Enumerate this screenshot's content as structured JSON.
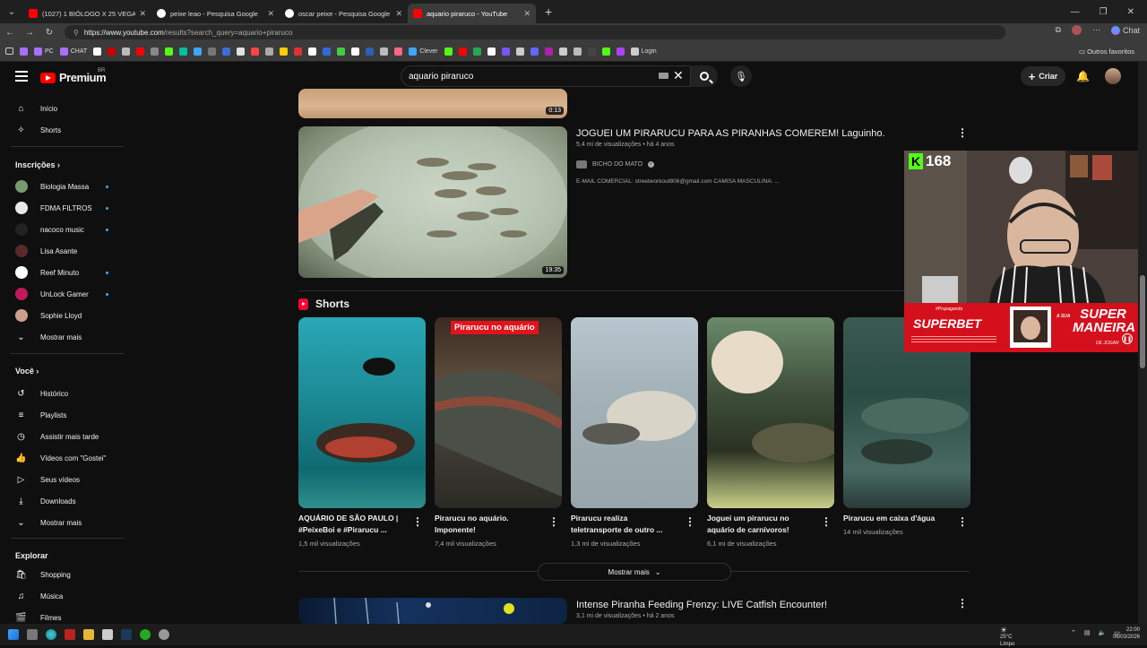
{
  "browser": {
    "tabs": [
      {
        "title": "(1027) 1 BIÓLOGO X 25 VEGANOS",
        "fav_color": "#ff0000",
        "active": false
      },
      {
        "title": "peixe leao - Pesquisa Google",
        "fav_color": "#ffffff",
        "active": false
      },
      {
        "title": "oscar peixe - Pesquisa Google",
        "fav_color": "#ffffff",
        "active": false
      },
      {
        "title": "aquario piraruco - YouTube",
        "fav_color": "#ff0000",
        "active": true
      }
    ],
    "url_host": "https://www.youtube.com",
    "url_path": "/results?search_query=aquario+piraruco",
    "chat_label": "Chat",
    "bookmarks": [
      {
        "label": "",
        "color": "#a970ff"
      },
      {
        "label": "PC",
        "color": "#a970ff"
      },
      {
        "label": "CHAT",
        "color": "#a970ff"
      },
      {
        "label": "",
        "color": "#ffffff"
      },
      {
        "label": "",
        "color": "#cc0000"
      },
      {
        "label": "",
        "color": "#bbbbbb"
      },
      {
        "label": "",
        "color": "#ff0000"
      },
      {
        "label": "",
        "color": "#888888"
      },
      {
        "label": "",
        "color": "#53fc18"
      },
      {
        "label": "",
        "color": "#00c0a0"
      },
      {
        "label": "",
        "color": "#3ea6ff"
      },
      {
        "label": "",
        "color": "#777777"
      },
      {
        "label": "",
        "color": "#3a6fd8"
      },
      {
        "label": "",
        "color": "#e0e0e0"
      },
      {
        "label": "",
        "color": "#ff4444"
      },
      {
        "label": "",
        "color": "#aaaaaa"
      },
      {
        "label": "",
        "color": "#ffcc00"
      },
      {
        "label": "",
        "color": "#d33"
      },
      {
        "label": "",
        "color": "#ffffff"
      },
      {
        "label": "",
        "color": "#2f6bd8"
      },
      {
        "label": "",
        "color": "#44cc44"
      },
      {
        "label": "",
        "color": "#ffffff"
      },
      {
        "label": "",
        "color": "#2b5fb8"
      },
      {
        "label": "",
        "color": "#bbbbbb"
      },
      {
        "label": "",
        "color": "#ff6688"
      },
      {
        "label": "Clever",
        "color": "#3ea6ff"
      },
      {
        "label": "",
        "color": "#53fc18"
      },
      {
        "label": "",
        "color": "#ff0000"
      },
      {
        "label": "",
        "color": "#22aa55"
      },
      {
        "label": "",
        "color": "#ffffff"
      },
      {
        "label": "",
        "color": "#7755ff"
      },
      {
        "label": "",
        "color": "#cccccc"
      },
      {
        "label": "",
        "color": "#6666ff"
      },
      {
        "label": "",
        "color": "#aa22aa"
      },
      {
        "label": "",
        "color": "#cccccc"
      },
      {
        "label": "",
        "color": "#bbbbbb"
      },
      {
        "label": "",
        "color": "#444444"
      },
      {
        "label": "",
        "color": "#53fc18"
      },
      {
        "label": "",
        "color": "#aa44ff"
      },
      {
        "label": "Login",
        "color": "#cccccc"
      }
    ],
    "bookmarks_other": "Outros favoritos"
  },
  "header": {
    "logo_text": "Premium",
    "logo_country": "BR",
    "search_value": "aquario piraruco",
    "create_label": "Criar"
  },
  "sidebar": {
    "main": [
      {
        "label": "Início",
        "icon": "home-icon",
        "glyph": "⌂"
      },
      {
        "label": "Shorts",
        "icon": "shorts-icon",
        "glyph": "✧"
      }
    ],
    "subs_heading": "Inscrições",
    "subs": [
      {
        "label": "Biologia Massa",
        "color": "#7a9a6b",
        "dot": true
      },
      {
        "label": "FDMA FILTROS",
        "color": "#e8e8e8",
        "dot": true
      },
      {
        "label": "nacoco music",
        "color": "#222222",
        "dot": true
      },
      {
        "label": "Lisa Asante",
        "color": "#5a2a2a",
        "dot": false
      },
      {
        "label": "Reef Minuto",
        "color": "#ffffff",
        "dot": true
      },
      {
        "label": "UnLock Gamer",
        "color": "#c2185b",
        "dot": true
      },
      {
        "label": "Sophie Lloyd",
        "color": "#caa08a",
        "dot": false
      }
    ],
    "subs_more": "Mostrar mais",
    "you_heading": "Você",
    "you": [
      {
        "label": "Histórico",
        "icon": "history-icon",
        "glyph": "↺"
      },
      {
        "label": "Playlists",
        "icon": "playlists-icon",
        "glyph": "≡"
      },
      {
        "label": "Assistir mais tarde",
        "icon": "clock-icon",
        "glyph": "◷"
      },
      {
        "label": "Vídeos com \"Gostei\"",
        "icon": "thumbs-up-icon",
        "glyph": "👍"
      },
      {
        "label": "Seus vídeos",
        "icon": "your-videos-icon",
        "glyph": "▷"
      },
      {
        "label": "Downloads",
        "icon": "download-icon",
        "glyph": "⤓"
      }
    ],
    "you_more": "Mostrar mais",
    "explore_heading": "Explorar",
    "explore": [
      {
        "label": "Shopping",
        "icon": "shopping-icon",
        "glyph": "🛍"
      },
      {
        "label": "Música",
        "icon": "music-icon",
        "glyph": "♫"
      },
      {
        "label": "Filmes",
        "icon": "movies-icon",
        "glyph": "🎬"
      }
    ]
  },
  "results": {
    "top_video": {
      "duration": "0:13"
    },
    "video1": {
      "title": "JOGUEI UM PIRARUCU PARA AS PIRANHAS COMEREM! Laguinho.",
      "meta": "5,4 mi de visualizações • há 4 anos",
      "channel": "BICHO DO MATO",
      "verified": "✓",
      "desc": "E-MAIL COMERCIAL: streetworkout806@gmail.com CAMISA MASCULINA: ...",
      "duration": "19:35"
    },
    "shorts_heading": "Shorts",
    "shorts": [
      {
        "line1": "AQUÁRIO DE SÃO PAULO |",
        "line2": "#PeixeBoi e #Pirarucu ...",
        "views": "1,5 mil visualizações",
        "overlay": ""
      },
      {
        "line1": "Pirarucu no aquário.",
        "line2": "Imponente!",
        "views": "7,4 mil visualizações",
        "overlay": "Pirarucu no aquário"
      },
      {
        "line1": "Pirarucu realiza",
        "line2": "teletransporte de outro ...",
        "views": "1,3 mi de visualizações",
        "overlay": ""
      },
      {
        "line1": "Joguei um pirarucu no",
        "line2": "aquário de carnívoros!",
        "views": "6,1 mi de visualizações",
        "overlay": ""
      },
      {
        "line1": "Pirarucu em caixa d'água",
        "line2": "",
        "views": "14 mil visualizações",
        "overlay": ""
      }
    ],
    "show_more": "Mostrar mais",
    "video2": {
      "title": "Intense Piranha Feeding Frenzy: LIVE Catfish Encounter!",
      "meta": "3,1 mi de visualizações • há 2 anos"
    }
  },
  "overlay": {
    "kick_logo": "K",
    "viewer_count": "168",
    "promo_tag": "#Propaganda",
    "brand": "SUPERBET",
    "slogan_small": "A SUA",
    "slogan_big": "SUPER MANEIRA",
    "slogan_end": "DE JOGAR"
  },
  "taskbar": {
    "temp": "25°C",
    "condition": "Limpo",
    "time": "22:00",
    "date": "06/03/2026"
  }
}
